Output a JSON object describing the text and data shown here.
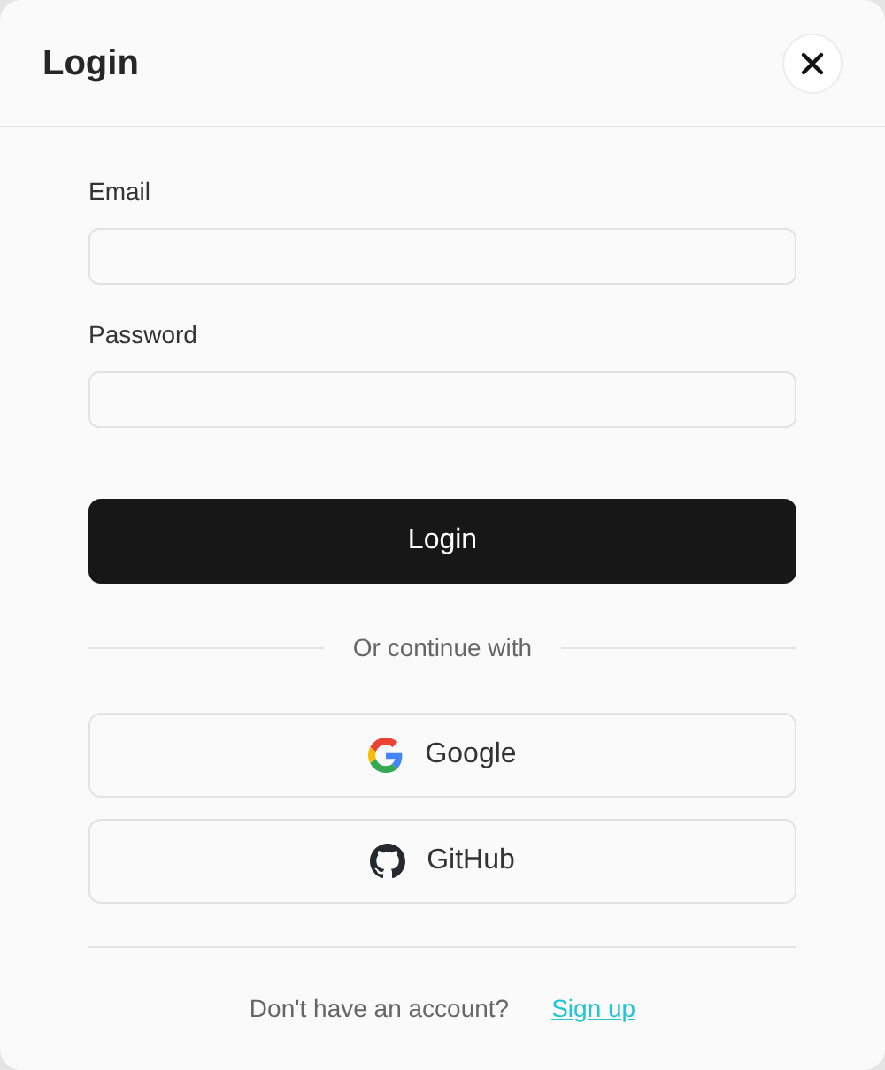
{
  "dialog": {
    "title": "Login"
  },
  "fields": [
    {
      "label": "Email"
    },
    {
      "label": "Password"
    }
  ],
  "submit": "Login",
  "divider_text": "Or continue with",
  "providers": [
    {
      "kind": "google",
      "label": "Google"
    },
    {
      "kind": "github",
      "label": "GitHub"
    }
  ],
  "footer": {
    "text": "Don't have an account?",
    "link": "Sign up"
  }
}
